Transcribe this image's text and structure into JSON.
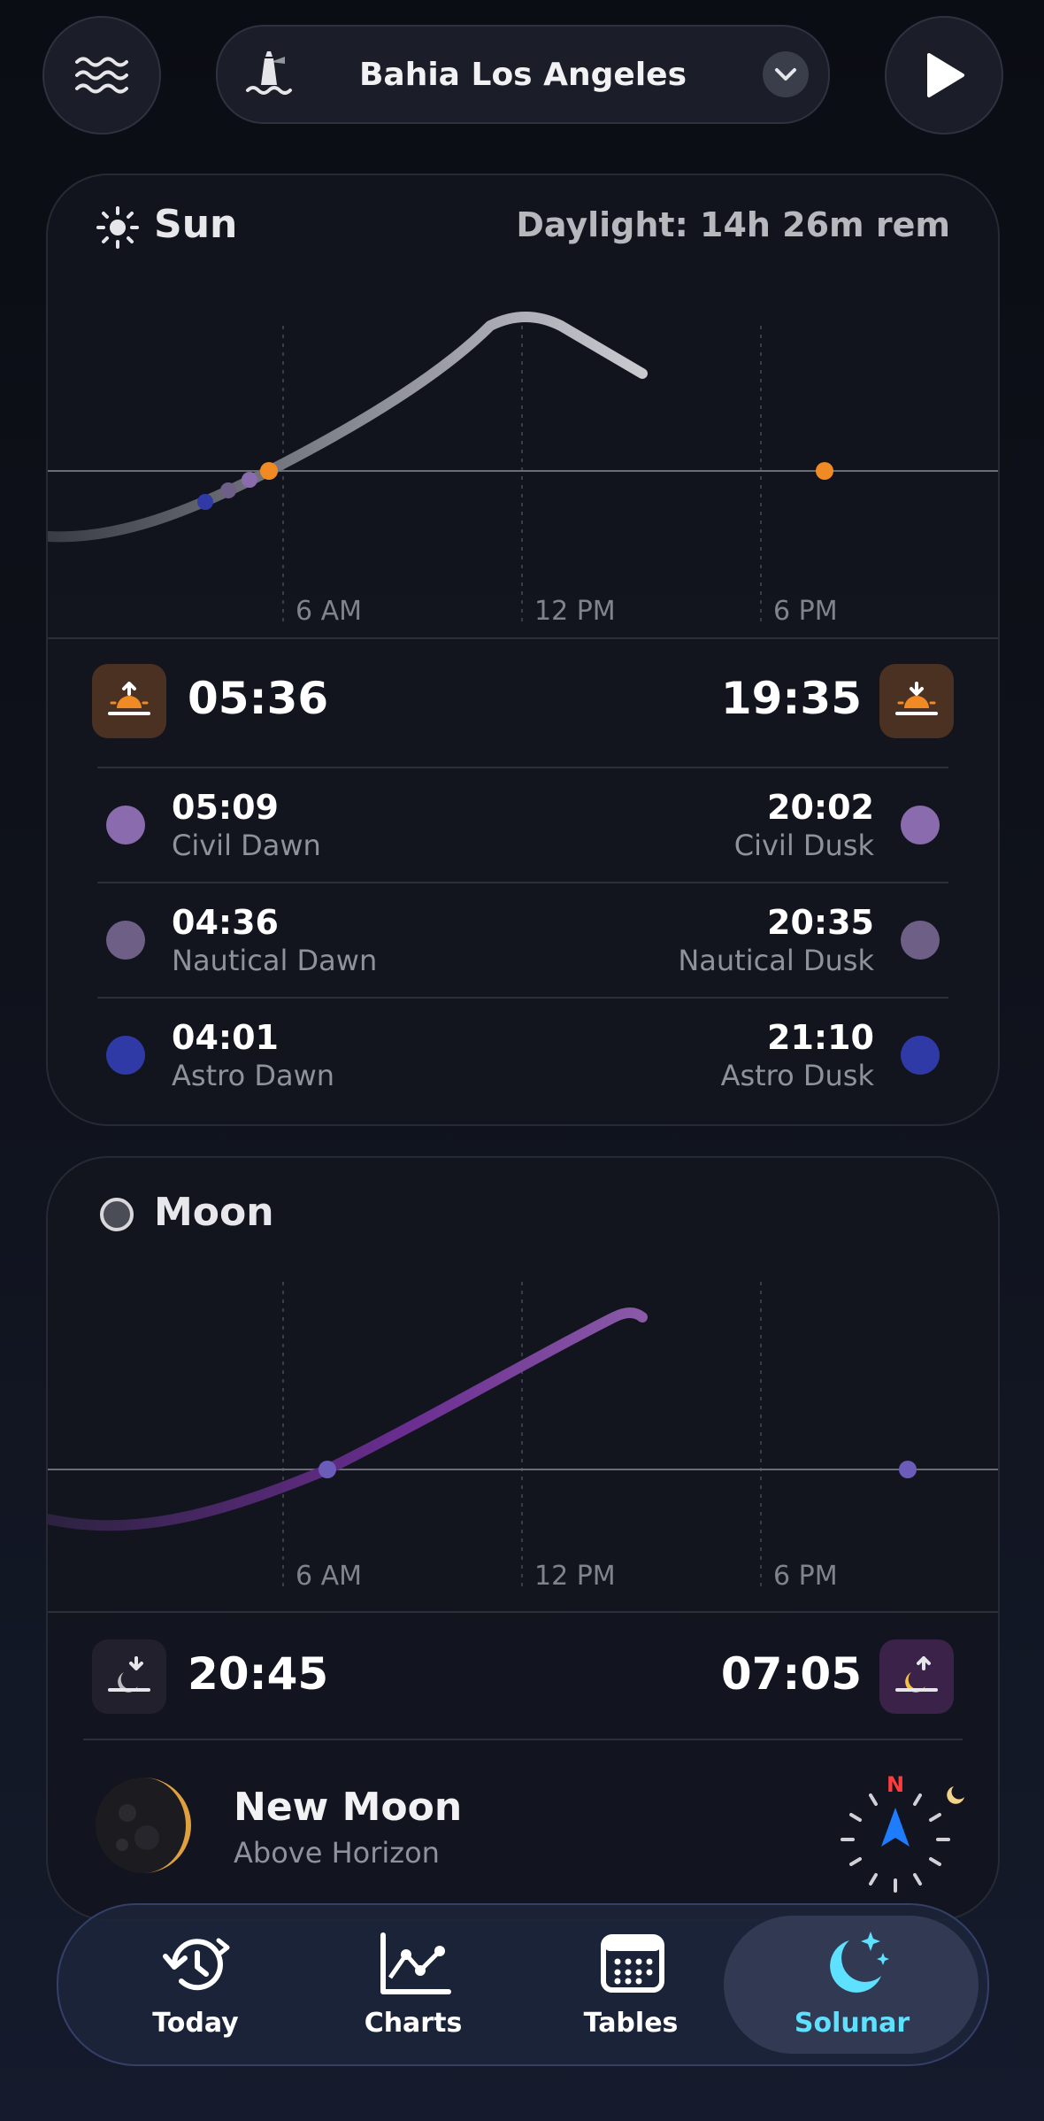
{
  "header": {
    "location": "Bahia Los Angeles"
  },
  "sun": {
    "title": "Sun",
    "daylight": "Daylight: 14h 26m rem",
    "ticks": [
      "6 AM",
      "12 PM",
      "6 PM"
    ],
    "sunrise": "05:36",
    "sunset": "19:35",
    "rows": [
      {
        "left_time": "05:09",
        "left_label": "Civil Dawn",
        "right_time": "20:02",
        "right_label": "Civil Dusk",
        "color": "#8a6cae"
      },
      {
        "left_time": "04:36",
        "left_label": "Nautical Dawn",
        "right_time": "20:35",
        "right_label": "Nautical Dusk",
        "color": "#6e5f86"
      },
      {
        "left_time": "04:01",
        "left_label": "Astro Dawn",
        "right_time": "21:10",
        "right_label": "Astro Dusk",
        "color": "#2f3aa6"
      }
    ]
  },
  "moon": {
    "title": "Moon",
    "ticks": [
      "6 AM",
      "12 PM",
      "6 PM"
    ],
    "moonset": "20:45",
    "moonrise": "07:05",
    "phase": "New Moon",
    "position": "Above Horizon",
    "compass_label": "N"
  },
  "nav": {
    "items": [
      {
        "label": "Today"
      },
      {
        "label": "Charts"
      },
      {
        "label": "Tables"
      },
      {
        "label": "Solunar"
      }
    ]
  },
  "colors": {
    "accent": "#5ee0ff",
    "sun_orange": "#f08a24",
    "moon_purple": "#7a3aa0"
  }
}
